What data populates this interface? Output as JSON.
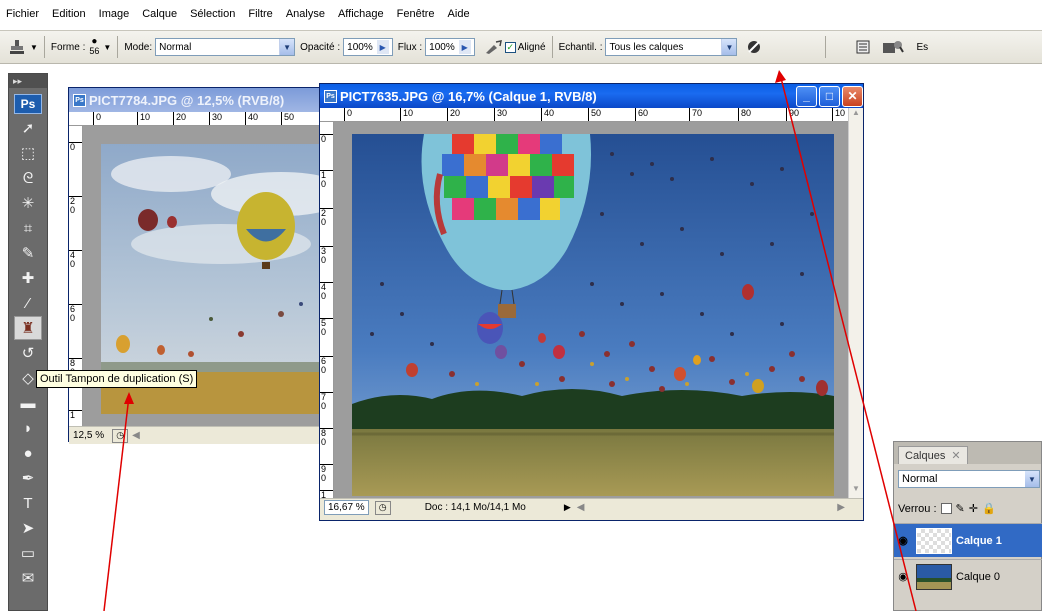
{
  "menu": [
    "Fichier",
    "Edition",
    "Image",
    "Calque",
    "Sélection",
    "Filtre",
    "Analyse",
    "Affichage",
    "Fenêtre",
    "Aide"
  ],
  "options": {
    "forme_label": "Forme :",
    "brush_size": "56",
    "mode_label": "Mode:",
    "mode_value": "Normal",
    "opacite_label": "Opacité :",
    "opacite_value": "100%",
    "flux_label": "Flux :",
    "flux_value": "100%",
    "aligne_label": "Aligné",
    "echantil_label": "Echantil. :",
    "echantil_value": "Tous les calques",
    "es_label": "Es"
  },
  "toolbox": {
    "logo": "Ps"
  },
  "win1": {
    "title": "PICT7784.JPG @ 12,5% (RVB/8)",
    "zoom": "12,5 %",
    "ruler_h": [
      "0",
      "10",
      "20",
      "30",
      "40",
      "50"
    ],
    "ruler_v": [
      "0",
      "2\n0",
      "4\n0",
      "6\n0",
      "8\n0",
      "1"
    ]
  },
  "win2": {
    "title": "PICT7635.JPG @ 16,7% (Calque 1, RVB/8)",
    "zoom": "16,67 %",
    "doc": "Doc : 14,1 Mo/14,1 Mo",
    "ruler_h": [
      "0",
      "10",
      "20",
      "30",
      "40",
      "50",
      "60",
      "70",
      "80",
      "90",
      "10"
    ],
    "ruler_v": [
      "0",
      "1\n0",
      "2\n0",
      "3\n0",
      "4\n0",
      "5\n0",
      "6\n0",
      "7\n0",
      "8\n0",
      "9\n0",
      "1"
    ]
  },
  "tooltip": "Outil Tampon de duplication (S)",
  "layers": {
    "tab": "Calques",
    "blend": "Normal",
    "lock_label": "Verrou :",
    "items": [
      "Calque 1",
      "Calque 0"
    ]
  },
  "colors": {
    "annotation_arrow": "#e00000",
    "selected_layer": "#316ac5"
  }
}
